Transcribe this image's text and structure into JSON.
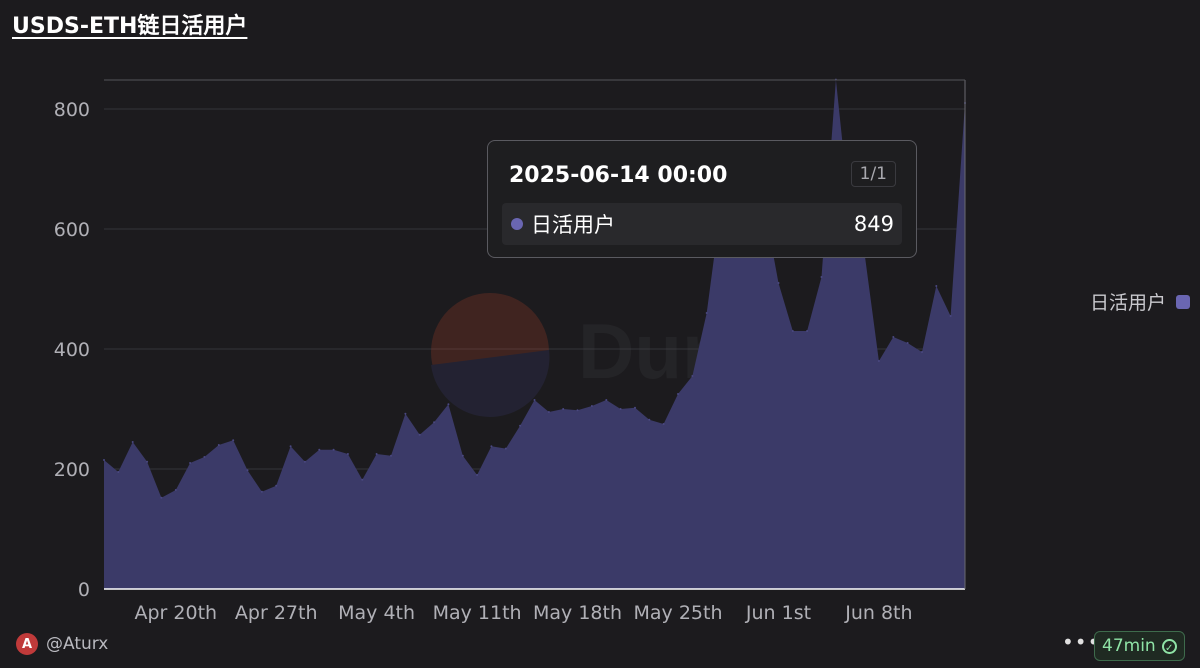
{
  "title": "USDS-ETH链日活用户",
  "chart_data": {
    "type": "area",
    "title": "USDS-ETH链日活用户",
    "series": [
      {
        "name": "日活用户",
        "color": "#6a66b2",
        "values": [
          215,
          195,
          245,
          212,
          152,
          165,
          210,
          220,
          240,
          248,
          198,
          162,
          172,
          238,
          212,
          232,
          232,
          225,
          182,
          225,
          222,
          292,
          257,
          278,
          308,
          222,
          190,
          238,
          234,
          272,
          315,
          295,
          300,
          298,
          305,
          315,
          300,
          302,
          282,
          275,
          325,
          355,
          460,
          640,
          650,
          580,
          640,
          510,
          430,
          430,
          520,
          849,
          620,
          560,
          380,
          420,
          410,
          395,
          505,
          455,
          810
        ]
      }
    ],
    "x_start": "2025-04-15",
    "x_tick_labels": [
      "Apr 20th",
      "Apr 27th",
      "May 4th",
      "May 11th",
      "May 18th",
      "May 25th",
      "Jun 1st",
      "Jun 8th"
    ],
    "y_ticks": [
      "0",
      "200",
      "400",
      "600",
      "800"
    ],
    "ylim": [
      0,
      850
    ],
    "grid": true,
    "legend_position": "right"
  },
  "tooltip": {
    "date": "2025-06-14 00:00",
    "page": "1/1",
    "series_label": "日活用户",
    "value": "849"
  },
  "legend": {
    "label": "日活用户"
  },
  "watermark": "Dune",
  "footer": {
    "user": "@Aturx",
    "more_icon": "ellipsis-icon",
    "refresh": "47min",
    "refresh_icon": "check-circle-icon"
  }
}
